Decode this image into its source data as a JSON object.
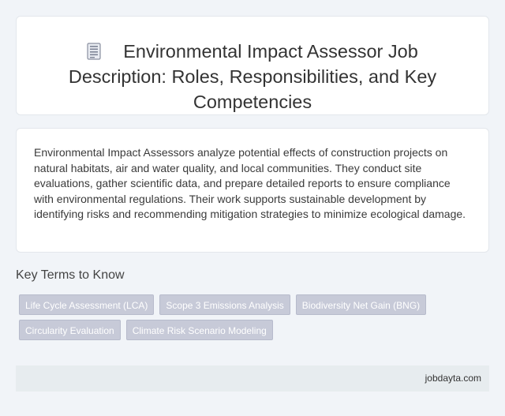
{
  "header": {
    "icon": "document-icon",
    "title": "Environmental Impact Assessor Job Description: Roles, Responsibilities, and Key Competencies"
  },
  "description": "Environmental Impact Assessors analyze potential effects of construction projects on natural habitats, air and water quality, and local communities. They conduct site evaluations, gather scientific data, and prepare detailed reports to ensure compliance with environmental regulations. Their work supports sustainable development by identifying risks and recommending mitigation strategies to minimize ecological damage.",
  "key_terms": {
    "heading": "Key Terms to Know",
    "tags": [
      "Life Cycle Assessment (LCA)",
      "Scope 3 Emissions Analysis",
      "Biodiversity Net Gain (BNG)",
      "Circularity Evaluation",
      "Climate Risk Scenario Modeling"
    ]
  },
  "footer": {
    "site": "jobdayta.com"
  }
}
